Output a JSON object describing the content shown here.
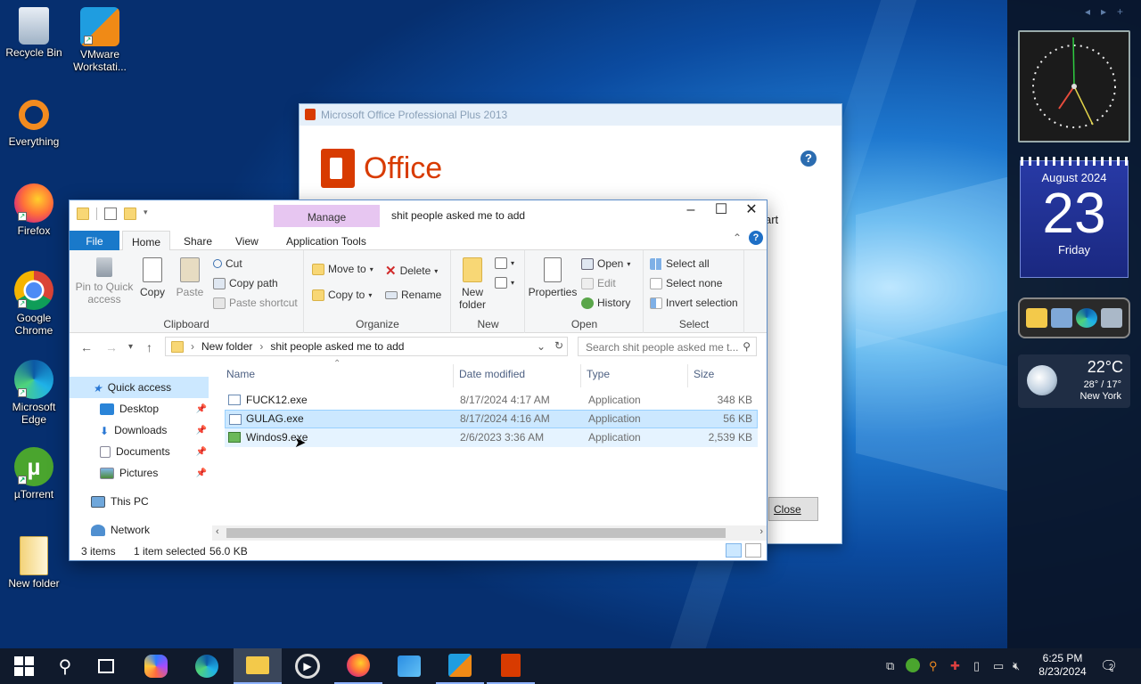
{
  "desktop_icons": [
    {
      "label": "Recycle Bin",
      "icon": "recycle-bin-icon"
    },
    {
      "label": "VMware Workstati...",
      "icon": "vmware-icon"
    },
    {
      "label": "Everything",
      "icon": "everything-search-icon"
    },
    {
      "label": "Firefox",
      "icon": "firefox-icon"
    },
    {
      "label": "Google Chrome",
      "icon": "chrome-icon"
    },
    {
      "label": "Microsoft Edge",
      "icon": "edge-icon"
    },
    {
      "label": "µTorrent",
      "icon": "utorrent-icon"
    },
    {
      "label": "New folder",
      "icon": "folder-icon"
    }
  ],
  "gadgets": {
    "calendar": {
      "month": "August 2024",
      "day": "23",
      "weekday": "Friday"
    },
    "weather": {
      "temp": "22°C",
      "hilo": "28° / 17°",
      "city": "New York"
    }
  },
  "office_dialog": {
    "title": "Microsoft Office Professional Plus 2013",
    "logo_text": "Office",
    "partial_text": "art",
    "close_label": "Close"
  },
  "explorer": {
    "manage_label": "Manage",
    "window_title": "shit people asked me to add",
    "tabs": [
      "File",
      "Home",
      "Share",
      "View",
      "Application Tools"
    ],
    "ribbon": {
      "clipboard": {
        "pin": "Pin to Quick access",
        "copy": "Copy",
        "paste": "Paste",
        "cut": "Cut",
        "copy_path": "Copy path",
        "paste_shortcut": "Paste shortcut",
        "label": "Clipboard"
      },
      "organize": {
        "move_to": "Move to",
        "copy_to": "Copy to",
        "delete": "Delete",
        "rename": "Rename",
        "label": "Organize"
      },
      "new": {
        "new_folder": "New folder",
        "label": "New"
      },
      "open": {
        "properties": "Properties",
        "open": "Open",
        "edit": "Edit",
        "history": "History",
        "label": "Open"
      },
      "select": {
        "select_all": "Select all",
        "select_none": "Select none",
        "invert": "Invert selection",
        "label": "Select"
      }
    },
    "path": [
      "New folder",
      "shit people asked me to add"
    ],
    "search_placeholder": "Search shit people asked me t...",
    "nav": {
      "quick_access": "Quick access",
      "desktop": "Desktop",
      "downloads": "Downloads",
      "documents": "Documents",
      "pictures": "Pictures",
      "this_pc": "This PC",
      "network": "Network"
    },
    "columns": [
      "Name",
      "Date modified",
      "Type",
      "Size"
    ],
    "files": [
      {
        "name": "FUCK12.exe",
        "date": "8/17/2024 4:17 AM",
        "type": "Application",
        "size": "348 KB"
      },
      {
        "name": "GULAG.exe",
        "date": "8/17/2024 4:16 AM",
        "type": "Application",
        "size": "56 KB"
      },
      {
        "name": "Windos9.exe",
        "date": "2/6/2023 3:36 AM",
        "type": "Application",
        "size": "2,539 KB"
      }
    ],
    "status": {
      "items": "3 items",
      "selected": "1 item selected",
      "size": "56.0 KB"
    }
  },
  "taskbar": {
    "time": "6:25 PM",
    "date": "8/23/2024",
    "notification_count": "2"
  }
}
